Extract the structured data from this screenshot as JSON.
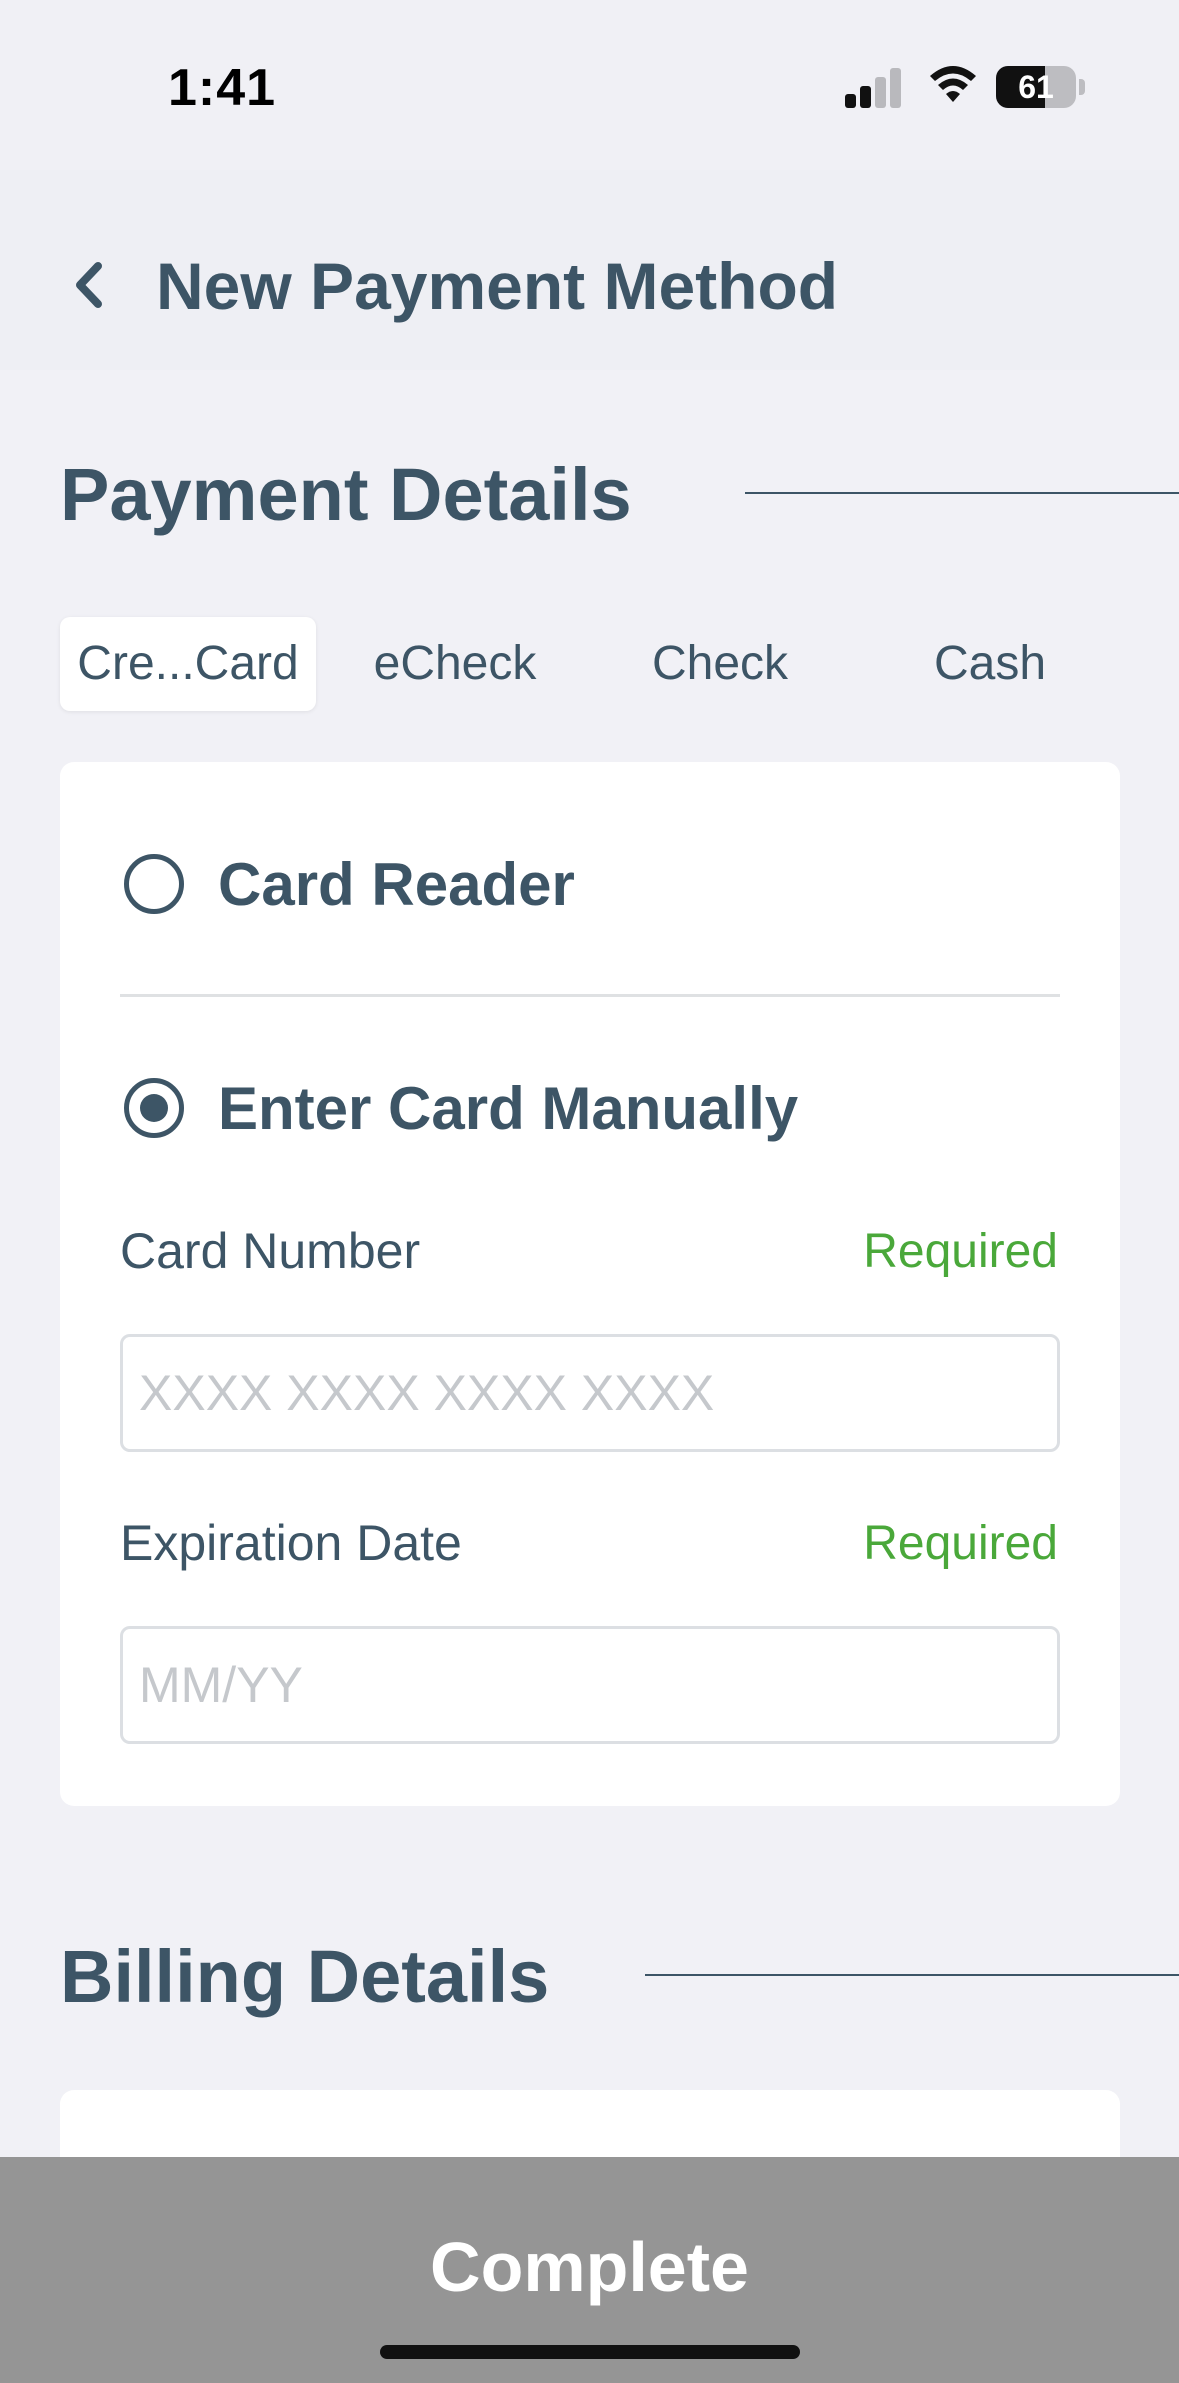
{
  "status_bar": {
    "time": "1:41",
    "battery_level": "61",
    "battery_fraction": 0.61,
    "signal_bars_active": 2,
    "signal_bars_total": 4
  },
  "header": {
    "back_icon": "chevron-left-icon",
    "title": "New Payment Method"
  },
  "payment_details": {
    "title": "Payment Details",
    "tabs": [
      {
        "label": "Cre...Card",
        "active": true
      },
      {
        "label": "eCheck",
        "active": false
      },
      {
        "label": "Check",
        "active": false
      },
      {
        "label": "Cash",
        "active": false
      }
    ],
    "options": [
      {
        "label": "Card Reader",
        "selected": false
      },
      {
        "label": "Enter Card Manually",
        "selected": true
      }
    ],
    "fields": {
      "card_number": {
        "label": "Card Number",
        "required": "Required",
        "placeholder": "XXXX XXXX XXXX XXXX",
        "value": ""
      },
      "expiration_date": {
        "label": "Expiration Date",
        "required": "Required",
        "placeholder": "MM/YY",
        "value": ""
      }
    }
  },
  "billing_details": {
    "title": "Billing Details"
  },
  "footer": {
    "complete_label": "Complete"
  },
  "colors": {
    "text": "#3d5566",
    "required": "#4aa83a",
    "background": "#f1f1f6",
    "footer": "#959595"
  }
}
